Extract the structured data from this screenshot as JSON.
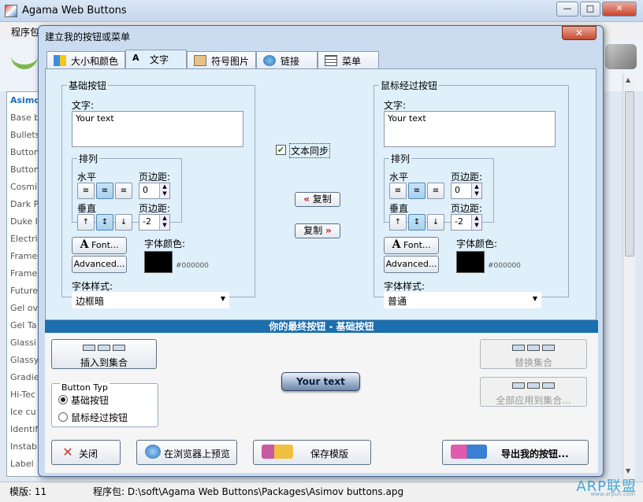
{
  "app": {
    "title": "Agama Web Buttons",
    "menu_label": "程序包",
    "window_controls": [
      "—",
      "□",
      "✕"
    ]
  },
  "left_list": [
    "Asimo",
    "Base b",
    "Bullets",
    "Button",
    "Button",
    "Cosmi",
    "Dark P",
    "Duke I",
    "Electri",
    "Frame",
    "Frame",
    "Future",
    "Gel ov",
    "Gel Ta",
    "Glassi",
    "Glassy",
    "Gradie",
    "Hi-Tec",
    "Ice cu",
    "Identif",
    "Instab",
    "Label"
  ],
  "dialog": {
    "title": "建立我的按钮或菜单",
    "close": "✕",
    "tabs": [
      "大小和颜色",
      "文字",
      "符号图片",
      "链接",
      "菜单"
    ],
    "base": {
      "group_title": "基础按钮",
      "text_label": "文字:",
      "text_value": "Your text",
      "align_title": "排列",
      "horizontal_label": "水平",
      "vertical_label": "垂直",
      "margin_label_1": "页边距:",
      "margin_value_1": "0",
      "margin_label_2": "页边距:",
      "margin_value_2": "-2",
      "font_button": "Font...",
      "advanced_button": "Advanced...",
      "color_label": "字体颜色:",
      "color_hex": "#000000",
      "style_label": "字体样式:",
      "style_value": "边框暗"
    },
    "hover": {
      "group_title": "鼠标经过按钮",
      "text_label": "文字:",
      "text_value": "Your text",
      "align_title": "排列",
      "horizontal_label": "水平",
      "vertical_label": "垂直",
      "margin_label_1": "页边距:",
      "margin_value_1": "0",
      "margin_label_2": "页边距:",
      "margin_value_2": "-2",
      "font_button": "Font...",
      "advanced_button": "Advanced...",
      "color_label": "字体颜色:",
      "color_hex": "#000000",
      "style_label": "字体样式:",
      "style_value": "普通"
    },
    "sync_label": "文本同步",
    "sync_checked": true,
    "copy_left": "复制",
    "copy_right": "复制",
    "final_title": "你的最终按钮 - 基础按钮",
    "insert_button": "插入到集合",
    "replace_button": "替换集合",
    "apply_all_button": "全部应用到集合...",
    "preview_text": "Your text",
    "button_type": {
      "title": "Button Typ",
      "options": [
        "基础按钮",
        "鼠标经过按钮"
      ],
      "selected": 0
    },
    "close_button": "关闭",
    "preview_browser_button": "在浏览器上预览",
    "save_template_button": "保存模版",
    "export_button": "导出我的按钮..."
  },
  "status": {
    "template_count": "模版: 11",
    "package_path": "程序包: D:\\soft\\Agama Web Buttons\\Packages\\Asimov buttons.apg"
  },
  "watermark": {
    "text": "ARP联盟",
    "url": "www.arpun.com"
  },
  "colors": {
    "accent": "#1b6fae",
    "font_color": "#000000"
  }
}
